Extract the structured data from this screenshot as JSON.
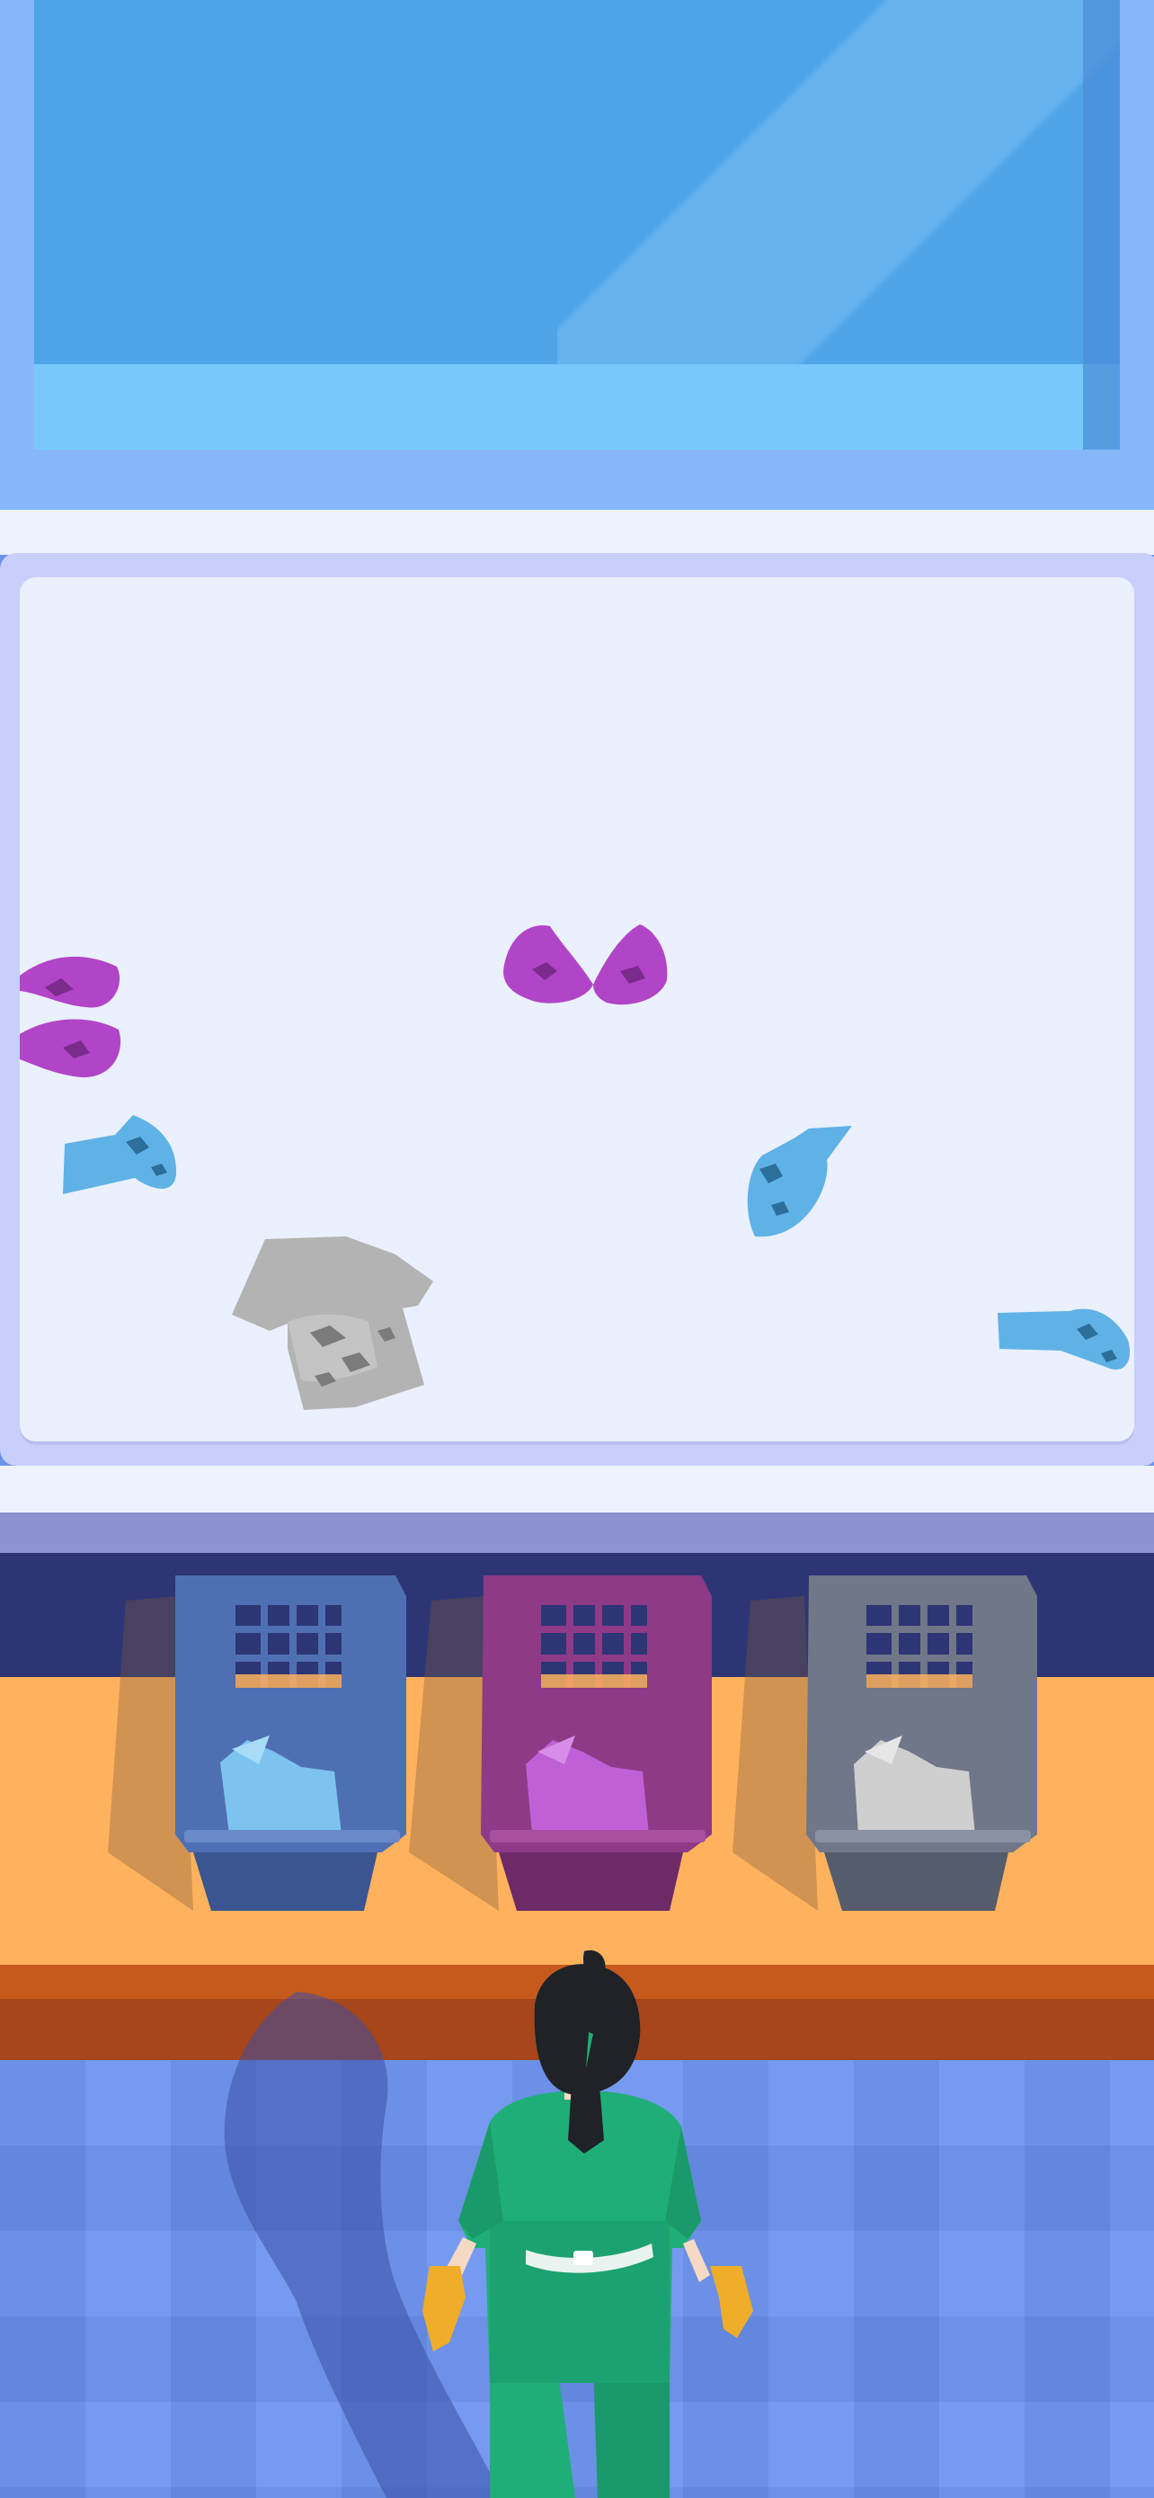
{
  "scene": {
    "name": "laundry-sorting-game",
    "colors": {
      "window_sky": "#4fa4e8",
      "window_frame": "#86b7fb",
      "table_top": "#e8eefc",
      "table_rim": "#c9cffb",
      "shelf_wall": "#2d3575",
      "shelf_counter": "#ffb25e",
      "counter_front": "#a6461a",
      "floor": "#6b93ee"
    }
  },
  "table": {
    "items": [
      {
        "name": "purple-bra-left",
        "kind": "bra",
        "color": "#b145c8"
      },
      {
        "name": "purple-bra-center",
        "kind": "bra",
        "color": "#b145c8"
      },
      {
        "name": "blue-sock-left",
        "kind": "sock",
        "color": "#5fb2e6"
      },
      {
        "name": "blue-sock-center",
        "kind": "sock",
        "color": "#5fb2e6"
      },
      {
        "name": "blue-sock-right",
        "kind": "sock",
        "color": "#5fb2e6"
      },
      {
        "name": "gray-tshirt",
        "kind": "t-shirt",
        "color": "#b3b3b3"
      }
    ]
  },
  "baskets": [
    {
      "name": "blue-basket",
      "color": "#4f6fb3",
      "dark": "#3a558f",
      "laundry_color": "#7cc4ef"
    },
    {
      "name": "purple-basket",
      "color": "#8e3a86",
      "dark": "#6d2a66",
      "laundry_color": "#c060d6"
    },
    {
      "name": "gray-basket",
      "color": "#6f7788",
      "dark": "#555c6b",
      "laundry_color": "#cfcfcf"
    }
  ],
  "character": {
    "name": "worker",
    "outfit_color": "#1fae78",
    "hair_color": "#1f2226",
    "glove_color": "#f0ad2a"
  }
}
